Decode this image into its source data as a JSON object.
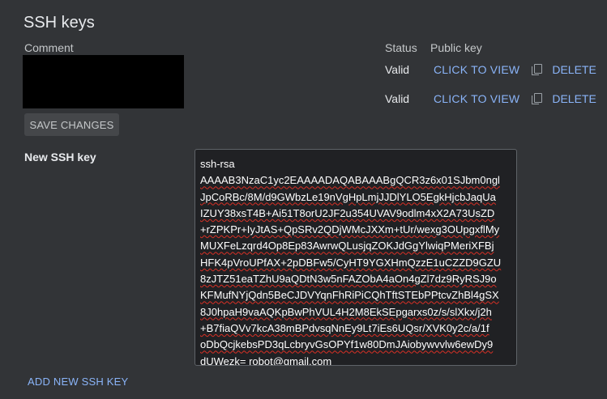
{
  "section_title": "SSH keys",
  "table": {
    "comment_header": "Comment",
    "status_header": "Status",
    "public_key_header": "Public key",
    "rows": [
      {
        "status": "Valid",
        "view_label": "CLICK TO VIEW",
        "delete_label": "DELETE"
      },
      {
        "status": "Valid",
        "view_label": "CLICK TO VIEW",
        "delete_label": "DELETE"
      }
    ]
  },
  "save_button": "SAVE CHANGES",
  "new_key": {
    "label": "New SSH key",
    "lines": [
      "ssh-rsa",
      "AAAAB3NzaC1yc2EAAAADAQABAAABgQCR3z6x01SJbm0ngl",
      "JpCoRBc/8M/d9GWbzLe19nVgHpLmjJJDlYLO5EgkHjcbJaqUa",
      "IZUY38xsT4B+Ai51T8orU2JF2u354UVAV9odlm4xX2A73UsZD",
      "+rZPKPr+IyJtAS+QpSRv2QDjWMcJXXm+tUr/wexg3OUpgxflMy",
      "MUXFeLzqrd4Op8Ep83AwrwQLusjqZOKJdGgYlwiqPMeriXFBj",
      "HFK4pVroUPfAX+2pDBFw5/CyHT9YGXHmQzzE1uCZZD9GZU",
      "8zJTZ51eaTZhU9aQDtN3w5nFAZObA4aOn4gZl7dz9RyRSJ9o",
      "KFMufNYjQdn5BeCJDVYqnFhRiPiCQhTftSTEbPPtcvZhBl4gSX",
      "8J0hpaH9vaAQKpBwPhVUL4H2M8EkSEpgarxs0z/s/slXkx/j2h",
      "+B7fiaQVv7kcA38mBPdvsqNnEy9Lt7iEs6UQsr/XVK0y2c/a/1f",
      "oDbQcjkebsPD3qLcbryvGsOPYf1w80DmJAiobywvvlw6ewDy9",
      "dUWezk= robot@gmail.com"
    ]
  },
  "add_key_label": "ADD NEW SSH KEY",
  "icons": {
    "copy": "copy-icon"
  },
  "colors": {
    "background": "#323437",
    "link": "#8ab4f8",
    "textarea_bg": "#202124",
    "spellcheck": "#d93025"
  }
}
